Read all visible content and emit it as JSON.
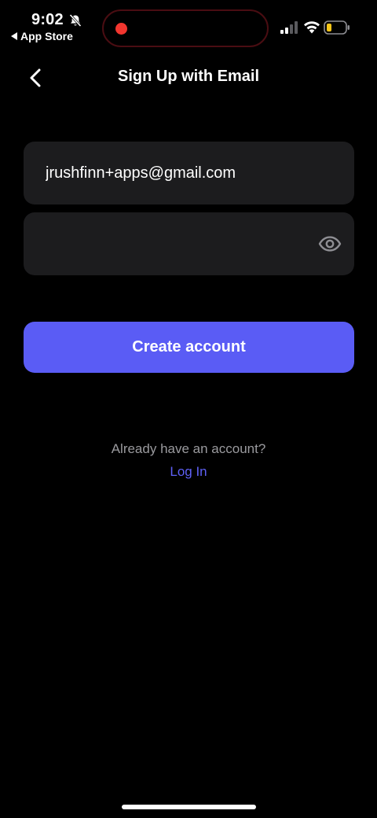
{
  "status_bar": {
    "time": "9:02",
    "back_app_label": "App Store",
    "icons": {
      "silent": "bell-slash-icon",
      "signal": "cellular-signal-icon",
      "wifi": "wifi-icon",
      "battery": "battery-low-icon"
    }
  },
  "nav": {
    "title": "Sign Up with Email",
    "back_icon": "chevron-left-icon"
  },
  "form": {
    "email_value": "jrushfinn+apps@gmail.com",
    "password_value": "",
    "password_toggle_icon": "eye-icon",
    "submit_label": "Create account"
  },
  "footer": {
    "prompt": "Already have an account?",
    "login_label": "Log In"
  },
  "colors": {
    "background": "#000000",
    "field": "#1c1c1e",
    "accent": "#5a5cf5",
    "link": "#5e60f5",
    "muted_text": "#9a9a9e",
    "recording": "#f2362f",
    "battery_low": "#f5c518"
  }
}
